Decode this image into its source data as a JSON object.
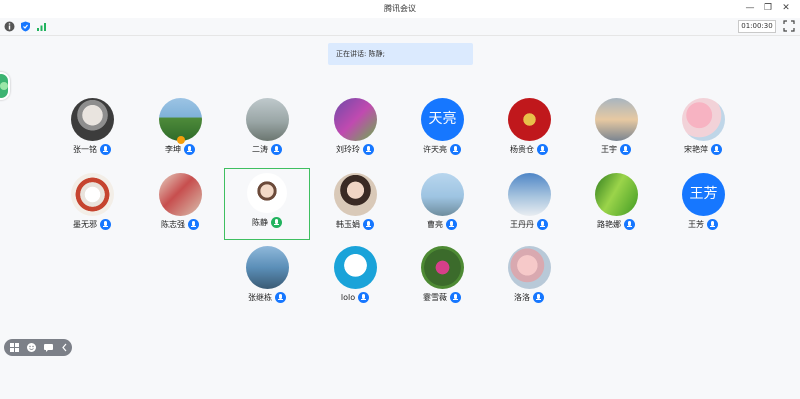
{
  "window": {
    "title": "腾讯会议"
  },
  "infobar": {
    "timer": "01:00:30"
  },
  "speaking": {
    "label": "正在讲话:",
    "name": "陈静;"
  },
  "participants": [
    {
      "name": "张一铭",
      "avatar": "photo"
    },
    {
      "name": "李坤",
      "avatar": "photo"
    },
    {
      "name": "二涛",
      "avatar": "photo"
    },
    {
      "name": "刘玲玲",
      "avatar": "photo"
    },
    {
      "name": "许天亮",
      "avatar": "text",
      "avatar_text": "天亮"
    },
    {
      "name": "杨贵仓",
      "avatar": "photo"
    },
    {
      "name": "王宇",
      "avatar": "photo"
    },
    {
      "name": "宋艳萍",
      "avatar": "photo"
    },
    {
      "name": "墨无邪",
      "avatar": "photo"
    },
    {
      "name": "陈志强",
      "avatar": "photo"
    },
    {
      "name": "陈静",
      "avatar": "photo",
      "active": true
    },
    {
      "name": "韩玉娟",
      "avatar": "photo"
    },
    {
      "name": "曹亮",
      "avatar": "photo"
    },
    {
      "name": "王丹丹",
      "avatar": "photo"
    },
    {
      "name": "路艳娜",
      "avatar": "photo"
    },
    {
      "name": "王芳",
      "avatar": "text",
      "avatar_text": "王芳"
    },
    {
      "name": "张继栋",
      "avatar": "photo"
    },
    {
      "name": "lolo",
      "avatar": "photo"
    },
    {
      "name": "霎雪薇",
      "avatar": "photo"
    },
    {
      "name": "洛洛",
      "avatar": "photo"
    }
  ],
  "colors": {
    "accent": "#1677ff",
    "active_border": "#3fbf60",
    "speaking_bg": "#dbeafe"
  }
}
